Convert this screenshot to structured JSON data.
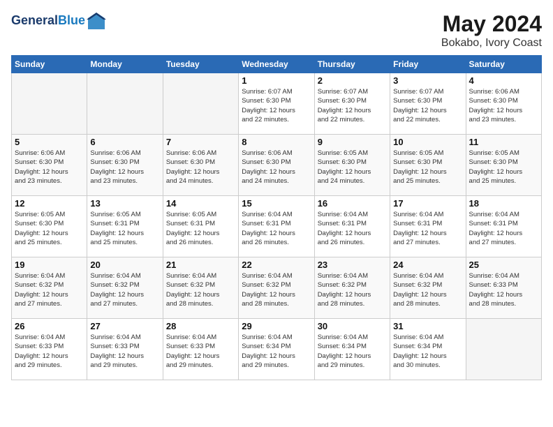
{
  "header": {
    "logo_line1": "General",
    "logo_line2": "Blue",
    "month": "May 2024",
    "location": "Bokabo, Ivory Coast"
  },
  "weekdays": [
    "Sunday",
    "Monday",
    "Tuesday",
    "Wednesday",
    "Thursday",
    "Friday",
    "Saturday"
  ],
  "weeks": [
    [
      {
        "day": "",
        "info": ""
      },
      {
        "day": "",
        "info": ""
      },
      {
        "day": "",
        "info": ""
      },
      {
        "day": "1",
        "info": "Sunrise: 6:07 AM\nSunset: 6:30 PM\nDaylight: 12 hours\nand 22 minutes."
      },
      {
        "day": "2",
        "info": "Sunrise: 6:07 AM\nSunset: 6:30 PM\nDaylight: 12 hours\nand 22 minutes."
      },
      {
        "day": "3",
        "info": "Sunrise: 6:07 AM\nSunset: 6:30 PM\nDaylight: 12 hours\nand 22 minutes."
      },
      {
        "day": "4",
        "info": "Sunrise: 6:06 AM\nSunset: 6:30 PM\nDaylight: 12 hours\nand 23 minutes."
      }
    ],
    [
      {
        "day": "5",
        "info": "Sunrise: 6:06 AM\nSunset: 6:30 PM\nDaylight: 12 hours\nand 23 minutes."
      },
      {
        "day": "6",
        "info": "Sunrise: 6:06 AM\nSunset: 6:30 PM\nDaylight: 12 hours\nand 23 minutes."
      },
      {
        "day": "7",
        "info": "Sunrise: 6:06 AM\nSunset: 6:30 PM\nDaylight: 12 hours\nand 24 minutes."
      },
      {
        "day": "8",
        "info": "Sunrise: 6:06 AM\nSunset: 6:30 PM\nDaylight: 12 hours\nand 24 minutes."
      },
      {
        "day": "9",
        "info": "Sunrise: 6:05 AM\nSunset: 6:30 PM\nDaylight: 12 hours\nand 24 minutes."
      },
      {
        "day": "10",
        "info": "Sunrise: 6:05 AM\nSunset: 6:30 PM\nDaylight: 12 hours\nand 25 minutes."
      },
      {
        "day": "11",
        "info": "Sunrise: 6:05 AM\nSunset: 6:30 PM\nDaylight: 12 hours\nand 25 minutes."
      }
    ],
    [
      {
        "day": "12",
        "info": "Sunrise: 6:05 AM\nSunset: 6:30 PM\nDaylight: 12 hours\nand 25 minutes."
      },
      {
        "day": "13",
        "info": "Sunrise: 6:05 AM\nSunset: 6:31 PM\nDaylight: 12 hours\nand 25 minutes."
      },
      {
        "day": "14",
        "info": "Sunrise: 6:05 AM\nSunset: 6:31 PM\nDaylight: 12 hours\nand 26 minutes."
      },
      {
        "day": "15",
        "info": "Sunrise: 6:04 AM\nSunset: 6:31 PM\nDaylight: 12 hours\nand 26 minutes."
      },
      {
        "day": "16",
        "info": "Sunrise: 6:04 AM\nSunset: 6:31 PM\nDaylight: 12 hours\nand 26 minutes."
      },
      {
        "day": "17",
        "info": "Sunrise: 6:04 AM\nSunset: 6:31 PM\nDaylight: 12 hours\nand 27 minutes."
      },
      {
        "day": "18",
        "info": "Sunrise: 6:04 AM\nSunset: 6:31 PM\nDaylight: 12 hours\nand 27 minutes."
      }
    ],
    [
      {
        "day": "19",
        "info": "Sunrise: 6:04 AM\nSunset: 6:32 PM\nDaylight: 12 hours\nand 27 minutes."
      },
      {
        "day": "20",
        "info": "Sunrise: 6:04 AM\nSunset: 6:32 PM\nDaylight: 12 hours\nand 27 minutes."
      },
      {
        "day": "21",
        "info": "Sunrise: 6:04 AM\nSunset: 6:32 PM\nDaylight: 12 hours\nand 28 minutes."
      },
      {
        "day": "22",
        "info": "Sunrise: 6:04 AM\nSunset: 6:32 PM\nDaylight: 12 hours\nand 28 minutes."
      },
      {
        "day": "23",
        "info": "Sunrise: 6:04 AM\nSunset: 6:32 PM\nDaylight: 12 hours\nand 28 minutes."
      },
      {
        "day": "24",
        "info": "Sunrise: 6:04 AM\nSunset: 6:32 PM\nDaylight: 12 hours\nand 28 minutes."
      },
      {
        "day": "25",
        "info": "Sunrise: 6:04 AM\nSunset: 6:33 PM\nDaylight: 12 hours\nand 28 minutes."
      }
    ],
    [
      {
        "day": "26",
        "info": "Sunrise: 6:04 AM\nSunset: 6:33 PM\nDaylight: 12 hours\nand 29 minutes."
      },
      {
        "day": "27",
        "info": "Sunrise: 6:04 AM\nSunset: 6:33 PM\nDaylight: 12 hours\nand 29 minutes."
      },
      {
        "day": "28",
        "info": "Sunrise: 6:04 AM\nSunset: 6:33 PM\nDaylight: 12 hours\nand 29 minutes."
      },
      {
        "day": "29",
        "info": "Sunrise: 6:04 AM\nSunset: 6:34 PM\nDaylight: 12 hours\nand 29 minutes."
      },
      {
        "day": "30",
        "info": "Sunrise: 6:04 AM\nSunset: 6:34 PM\nDaylight: 12 hours\nand 29 minutes."
      },
      {
        "day": "31",
        "info": "Sunrise: 6:04 AM\nSunset: 6:34 PM\nDaylight: 12 hours\nand 30 minutes."
      },
      {
        "day": "",
        "info": ""
      }
    ]
  ]
}
